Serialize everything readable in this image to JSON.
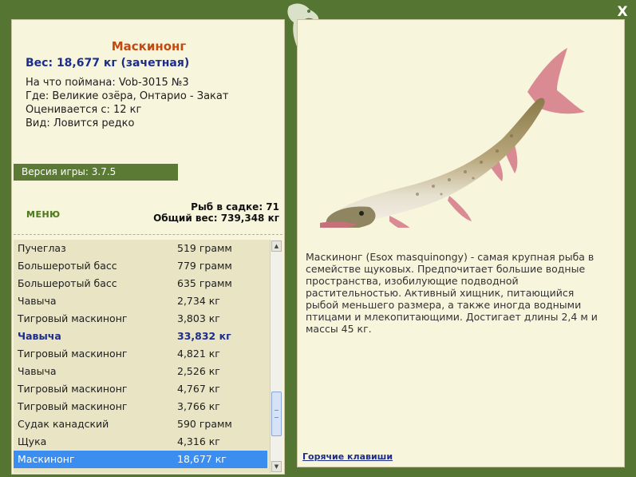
{
  "close_label": "X",
  "fish": {
    "title": "Маскинонг",
    "weight": "Вес: 18,677 кг (зачетная)",
    "caught_with": "На что поймана: Vob-3015 №3",
    "location": "Где: Великие озёра, Онтарио - Закат",
    "rated_from": "Оценивается с: 12 кг",
    "species_note": "Вид: Ловится редко",
    "description": "Маскинонг (Esox masquinongy) - самая крупная рыба в семействе щуковых. Предпочитает большие водные пространства, изобилующие подводной растительностью. Активный хищник, питающийся рыбой меньшего размера, а также иногда водными птицами и млекопитающими. Достигает длины 2,4 м и массы 45 кг."
  },
  "version": "Версия игры: 3.7.5",
  "menu_label": "МЕНЮ",
  "stats": {
    "fish_count": "Рыб в садке: 71",
    "total_weight": "Общий вес: 739,348 кг"
  },
  "catch_list": [
    {
      "name": "Пучеглаз",
      "weight": "519 грамм"
    },
    {
      "name": "Большеротый басс",
      "weight": "779 грамм"
    },
    {
      "name": "Большеротый басс",
      "weight": "635 грамм"
    },
    {
      "name": "Чавыча",
      "weight": "2,734 кг"
    },
    {
      "name": "Тигровый маскинонг",
      "weight": "3,803 кг"
    },
    {
      "name": "Чавыча",
      "weight": "33,832 кг"
    },
    {
      "name": "Тигровый маскинонг",
      "weight": "4,821 кг"
    },
    {
      "name": "Чавыча",
      "weight": "2,526 кг"
    },
    {
      "name": "Тигровый маскинонг",
      "weight": "4,767 кг"
    },
    {
      "name": "Тигровый маскинонг",
      "weight": "3,766 кг"
    },
    {
      "name": "Судак канадский",
      "weight": "590 грамм"
    },
    {
      "name": "Щука",
      "weight": "4,316 кг"
    },
    {
      "name": "Маскинонг",
      "weight": "18,677 кг"
    }
  ],
  "hotkeys_label": "Горячие клавиши",
  "colors": {
    "frame": "#557532",
    "panel": "#f8f5dd",
    "title": "#c24a10",
    "accent_blue": "#1c2d8a",
    "selection": "#3b8ef0"
  }
}
